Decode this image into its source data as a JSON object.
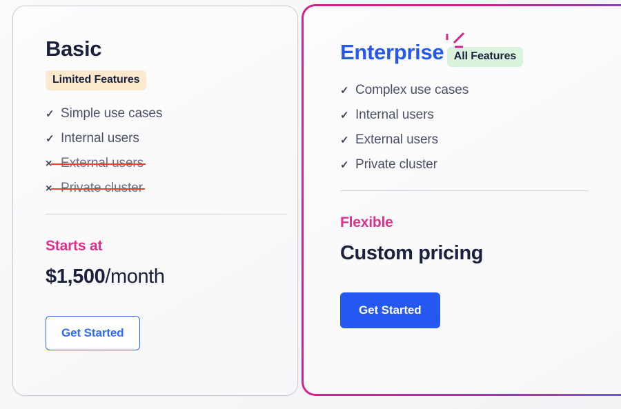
{
  "theme": {
    "page_background": "#f7f7f9",
    "accent_blue": "#2558f0",
    "accent_pink": "#e0308c",
    "border_gradient_from": "#d4228c",
    "border_gradient_to": "#6b52e8",
    "basic_border": "#c9ccd4",
    "strike_red": "#e8452a",
    "badge_limited_bg": "#fbeacd",
    "badge_all_bg": "#d9f3dd",
    "text_dark": "#19213d",
    "text_muted": "#4a5166"
  },
  "plans": [
    {
      "id": "basic",
      "title": "Basic",
      "badge": "Limited Features",
      "features": [
        {
          "label": "Simple use cases",
          "mark": "✓",
          "included": true
        },
        {
          "label": "Internal users",
          "mark": "✓",
          "included": true
        },
        {
          "label": "External users",
          "mark": "×",
          "included": false
        },
        {
          "label": "Private cluster",
          "mark": "×",
          "included": false
        }
      ],
      "price_label": "Starts at",
      "price_amount": "$1,500",
      "price_period": "/month",
      "cta": "Get Started"
    },
    {
      "id": "enterprise",
      "title": "Enterprise",
      "badge": "All Features",
      "features": [
        {
          "label": "Complex use cases",
          "mark": "✓",
          "included": true
        },
        {
          "label": "Internal users",
          "mark": "✓",
          "included": true
        },
        {
          "label": "External users",
          "mark": "✓",
          "included": true
        },
        {
          "label": "Private cluster",
          "mark": "✓",
          "included": true
        }
      ],
      "price_label": "Flexible",
      "price_value": "Custom pricing",
      "cta": "Get Started"
    }
  ]
}
